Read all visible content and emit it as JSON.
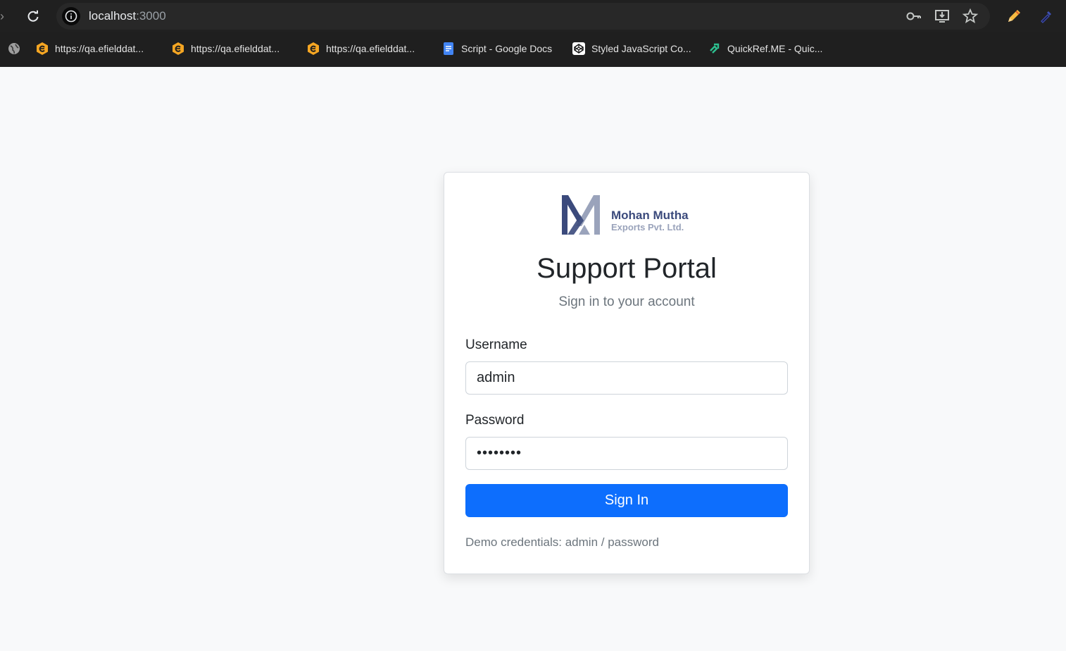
{
  "browser": {
    "url_host": "localhost",
    "url_port": ":3000",
    "bookmarks": [
      {
        "label": "https://qa.efielddat...",
        "icon": "efield-icon"
      },
      {
        "label": "https://qa.efielddat...",
        "icon": "efield-icon"
      },
      {
        "label": "https://qa.efielddat...",
        "icon": "efield-icon"
      },
      {
        "label": "Script - Google Docs",
        "icon": "google-docs-icon"
      },
      {
        "label": "Styled JavaScript Co...",
        "icon": "codepen-icon"
      },
      {
        "label": "QuickRef.ME - Quic...",
        "icon": "quickref-icon"
      }
    ]
  },
  "login": {
    "logo_name": "Mohan Mutha",
    "logo_sub": "Exports Pvt. Ltd.",
    "title": "Support Portal",
    "subtitle": "Sign in to your account",
    "username_label": "Username",
    "username_value": "admin",
    "password_label": "Password",
    "password_value": "password",
    "submit_label": "Sign In",
    "demo_text": "Demo credentials: admin / password"
  },
  "colors": {
    "primary": "#0d6efd",
    "brand_dark": "#3b4a7c",
    "brand_light": "#9aa3bb",
    "background": "#f8f9fa"
  }
}
